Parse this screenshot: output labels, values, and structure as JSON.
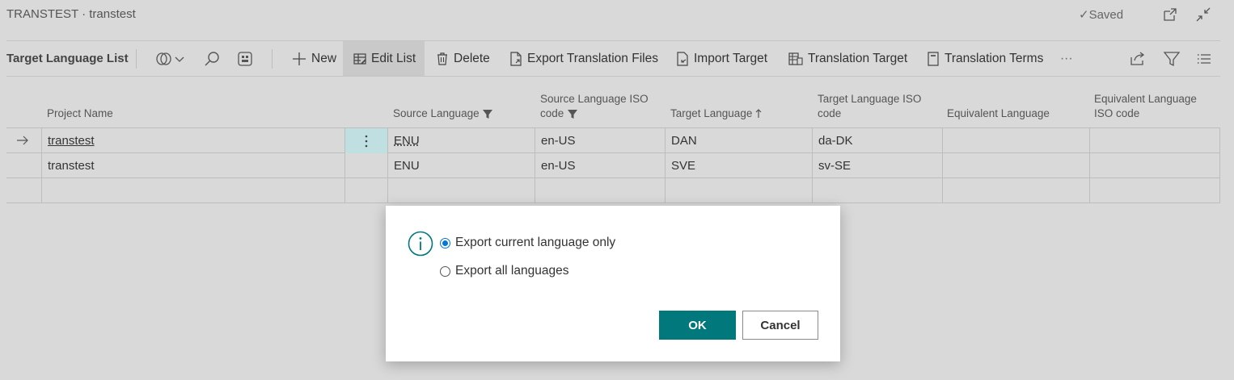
{
  "header": {
    "breadcrumb": "TRANSTEST · transtest",
    "saved_status": "✓Saved"
  },
  "actionbar": {
    "page_name": "Target Language List",
    "new": "New",
    "edit_list": "Edit List",
    "delete": "Delete",
    "export_translation_files": "Export Translation Files",
    "import_target": "Import Target",
    "translation_target": "Translation Target",
    "translation_terms": "Translation Terms",
    "more": "···"
  },
  "columns": {
    "project_name": "Project Name",
    "source_language": "Source Language",
    "source_iso_line1": "Source Language ISO",
    "source_iso_line2": "code",
    "target_language": "Target Language",
    "target_iso_line1": "Target Language ISO",
    "target_iso_line2": "code",
    "equivalent_language": "Equivalent Language",
    "equivalent_iso_line1": "Equivalent Language",
    "equivalent_iso_line2": "ISO code"
  },
  "rows": [
    {
      "project_name": "transtest",
      "source_language": "ENU",
      "source_iso": "en-US",
      "target_language": "DAN",
      "target_iso": "da-DK",
      "equivalent_language": "",
      "equivalent_iso": ""
    },
    {
      "project_name": "transtest",
      "source_language": "ENU",
      "source_iso": "en-US",
      "target_language": "SVE",
      "target_iso": "sv-SE",
      "equivalent_language": "",
      "equivalent_iso": ""
    }
  ],
  "dialog": {
    "option_current": "Export current language only",
    "option_all": "Export all languages",
    "selected": "Export current language only",
    "ok": "OK",
    "cancel": "Cancel"
  },
  "colors": {
    "accent": "#00787c",
    "radio_selected": "#0078d4",
    "selected_cell": "#bfdfe0"
  }
}
